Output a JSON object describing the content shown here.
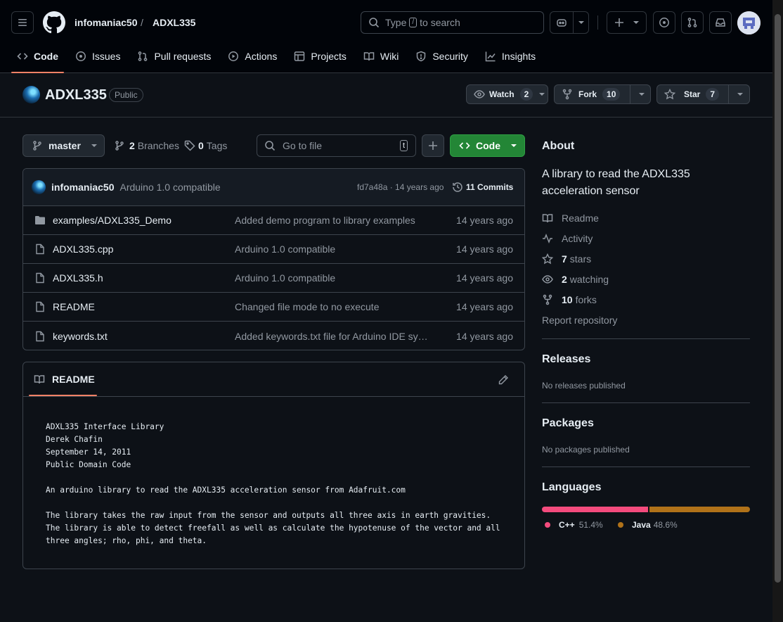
{
  "header": {
    "owner": "infomaniac50",
    "separator": "/",
    "repo": "ADXL335",
    "search_prefix": "Type",
    "search_key": "/",
    "search_suffix": "to search"
  },
  "tabs": [
    {
      "label": "Code",
      "icon": "code-icon",
      "selected": true
    },
    {
      "label": "Issues",
      "icon": "issue-icon"
    },
    {
      "label": "Pull requests",
      "icon": "pull-request-icon"
    },
    {
      "label": "Actions",
      "icon": "play-icon"
    },
    {
      "label": "Projects",
      "icon": "table-icon"
    },
    {
      "label": "Wiki",
      "icon": "book-icon"
    },
    {
      "label": "Security",
      "icon": "shield-icon"
    },
    {
      "label": "Insights",
      "icon": "graph-icon"
    }
  ],
  "repo": {
    "name": "ADXL335",
    "visibility": "Public",
    "watch_label": "Watch",
    "watch_count": "2",
    "fork_label": "Fork",
    "fork_count": "10",
    "star_label": "Star",
    "star_count": "7"
  },
  "filebar": {
    "branch": "master",
    "branches_count": "2",
    "branches_label": "Branches",
    "tags_count": "0",
    "tags_label": "Tags",
    "goto_placeholder": "Go to file",
    "goto_key": "t",
    "code_label": "Code"
  },
  "commit": {
    "author": "infomaniac50",
    "message": "Arduino 1.0 compatible",
    "hash_time": "fd7a48a · 14 years ago",
    "commits_label": "11 Commits"
  },
  "files": [
    {
      "type": "folder",
      "name": "examples/ADXL335_Demo",
      "message": "Added demo program to library examples",
      "age": "14 years ago"
    },
    {
      "type": "file",
      "name": "ADXL335.cpp",
      "message": "Arduino 1.0 compatible",
      "age": "14 years ago"
    },
    {
      "type": "file",
      "name": "ADXL335.h",
      "message": "Arduino 1.0 compatible",
      "age": "14 years ago"
    },
    {
      "type": "file",
      "name": "README",
      "message": "Changed file mode to no execute",
      "age": "14 years ago"
    },
    {
      "type": "file",
      "name": "keywords.txt",
      "message": "Added keywords.txt file for Arduino IDE sy…",
      "age": "14 years ago"
    }
  ],
  "readme": {
    "title": "README",
    "content": "ADXL335 Interface Library\nDerek Chafin\nSeptember 14, 2011\nPublic Domain Code\n\nAn arduino library to read the ADXL335 acceleration sensor from Adafruit.com\n\nThe library takes the raw input from the sensor and outputs all three axis in earth gravities.\nThe library is able to detect freefall as well as calculate the hypotenuse of the vector and all\nthree angles; rho, phi, and theta."
  },
  "about": {
    "heading": "About",
    "description": "A library to read the ADXL335 acceleration sensor",
    "readme_link": "Readme",
    "activity_link": "Activity",
    "stars_count": "7",
    "stars_label": "stars",
    "watching_count": "2",
    "watching_label": "watching",
    "forks_count": "10",
    "forks_label": "forks",
    "report_link": "Report repository"
  },
  "releases": {
    "heading": "Releases",
    "text": "No releases published"
  },
  "packages": {
    "heading": "Packages",
    "text": "No packages published"
  },
  "languages": {
    "heading": "Languages",
    "items": [
      {
        "name": "C++",
        "percent": "51.4%",
        "value": 51.4,
        "color": "#f34b7d"
      },
      {
        "name": "Java",
        "percent": "48.6%",
        "value": 48.6,
        "color": "#b07219"
      }
    ]
  }
}
